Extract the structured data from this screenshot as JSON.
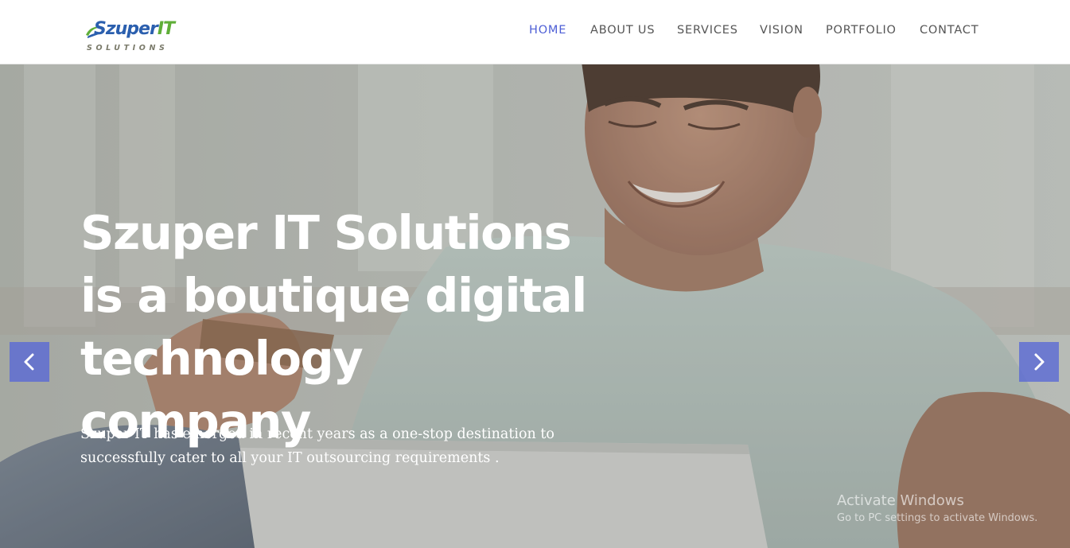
{
  "brand": {
    "logo_main": "Szuper",
    "logo_accent": "IT",
    "logo_sub": "SOLUTIONS",
    "colors": {
      "primary": "#2b5fae",
      "accent": "#5fae38",
      "nav_active": "#4e5fd6"
    }
  },
  "nav": {
    "items": [
      {
        "label": "HOME",
        "active": true
      },
      {
        "label": "ABOUT US",
        "active": false
      },
      {
        "label": "SERVICES",
        "active": false
      },
      {
        "label": "VISION",
        "active": false
      },
      {
        "label": "PORTFOLIO",
        "active": false
      },
      {
        "label": "CONTACT",
        "active": false
      }
    ]
  },
  "hero": {
    "headline": "Szuper IT Solutions is a boutique digital technology company",
    "subtext": "Szuper IT has emerged in recent years as a one-stop destination to successfully cater to all your IT outsourcing requirements .",
    "prev_icon": "chevron-left-icon",
    "next_icon": "chevron-right-icon"
  },
  "watermark": {
    "title": "Activate Windows",
    "subtitle": "Go to PC settings to activate Windows."
  }
}
